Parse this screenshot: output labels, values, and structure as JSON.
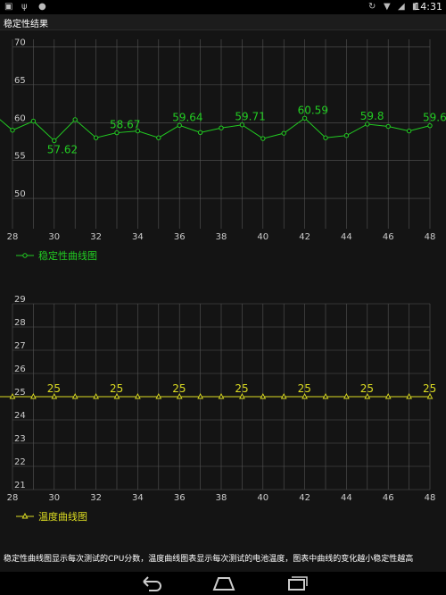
{
  "status_bar": {
    "time": "14:31",
    "left_icons": [
      "image-icon",
      "usb-icon",
      "android-icon"
    ],
    "right_icons": [
      "screen-rotation-icon",
      "wifi-icon",
      "signal-icon",
      "battery-icon"
    ]
  },
  "title": "稳定性结果",
  "footer_note": "稳定性曲线图显示每次测试的CPU分数，温度曲线图表显示每次测试的电池温度，图表中曲线的变化越小稳定性越高",
  "colors": {
    "stability_line": "#22cc22",
    "temperature_line": "#dddd22",
    "grid": "#555555",
    "axis_text": "#cccccc"
  },
  "chart_data": [
    {
      "type": "line",
      "legend": {
        "label": "稳定性曲线图",
        "position": "bottom-left"
      },
      "x": [
        28,
        29,
        30,
        31,
        32,
        33,
        34,
        35,
        36,
        37,
        38,
        39,
        40,
        41,
        42,
        43,
        44,
        45,
        46,
        47,
        48
      ],
      "values": [
        59.0,
        60.2,
        57.62,
        60.4,
        58.0,
        58.67,
        58.9,
        58.0,
        59.64,
        58.7,
        59.3,
        59.71,
        57.9,
        58.6,
        60.59,
        58.0,
        58.3,
        59.8,
        59.5,
        58.9,
        59.6
      ],
      "point_labels": [
        {
          "index": 2,
          "text": "57.62"
        },
        {
          "index": 5,
          "text": "58.67"
        },
        {
          "index": 8,
          "text": "59.64"
        },
        {
          "index": 11,
          "text": "59.71"
        },
        {
          "index": 14,
          "text": "60.59"
        },
        {
          "index": 17,
          "text": "59.8"
        },
        {
          "index": 20,
          "text": "59.6"
        }
      ],
      "xlim": [
        28,
        48
      ],
      "ylim": [
        46,
        71
      ],
      "x_ticks": [
        28,
        30,
        32,
        34,
        36,
        38,
        40,
        42,
        44,
        46,
        48
      ],
      "y_ticks": [
        50,
        55,
        60,
        65,
        70
      ],
      "marker": "circle",
      "grid": true
    },
    {
      "type": "line",
      "legend": {
        "label": "温度曲线图",
        "position": "bottom-left"
      },
      "x": [
        28,
        29,
        30,
        31,
        32,
        33,
        34,
        35,
        36,
        37,
        38,
        39,
        40,
        41,
        42,
        43,
        44,
        45,
        46,
        47,
        48
      ],
      "values": [
        25,
        25,
        25,
        25,
        25,
        25,
        25,
        25,
        25,
        25,
        25,
        25,
        25,
        25,
        25,
        25,
        25,
        25,
        25,
        25,
        25
      ],
      "point_labels": [
        {
          "index": 2,
          "text": "25"
        },
        {
          "index": 5,
          "text": "25"
        },
        {
          "index": 8,
          "text": "25"
        },
        {
          "index": 11,
          "text": "25"
        },
        {
          "index": 14,
          "text": "25"
        },
        {
          "index": 17,
          "text": "25"
        },
        {
          "index": 20,
          "text": "25"
        }
      ],
      "xlim": [
        28,
        48
      ],
      "ylim": [
        21,
        29
      ],
      "x_ticks": [
        28,
        30,
        32,
        34,
        36,
        38,
        40,
        42,
        44,
        46,
        48
      ],
      "y_ticks": [
        21,
        22,
        23,
        24,
        25,
        26,
        27,
        28,
        29
      ],
      "marker": "triangle",
      "grid": true
    }
  ]
}
